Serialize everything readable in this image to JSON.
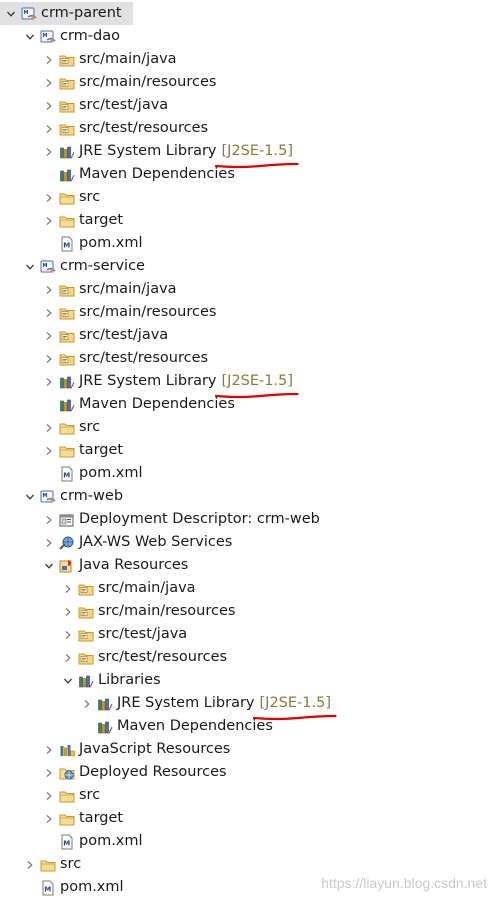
{
  "tree": [
    {
      "label": "crm-parent",
      "level": 0,
      "arrow": "expanded",
      "icon": "maven-project-icon",
      "selected": true
    },
    {
      "label": "crm-dao",
      "level": 1,
      "arrow": "expanded",
      "icon": "maven-project-icon"
    },
    {
      "label": "src/main/java",
      "level": 2,
      "arrow": "collapsed",
      "icon": "source-folder-icon"
    },
    {
      "label": "src/main/resources",
      "level": 2,
      "arrow": "collapsed",
      "icon": "source-folder-icon"
    },
    {
      "label": "src/test/java",
      "level": 2,
      "arrow": "collapsed",
      "icon": "source-folder-icon"
    },
    {
      "label": "src/test/resources",
      "level": 2,
      "arrow": "collapsed",
      "icon": "source-folder-icon"
    },
    {
      "label": "JRE System Library",
      "suffix": "[J2SE-1.5]",
      "level": 2,
      "arrow": "collapsed",
      "icon": "library-icon",
      "underline": true
    },
    {
      "label": "Maven Dependencies",
      "level": 2,
      "arrow": "none",
      "icon": "library-icon"
    },
    {
      "label": "src",
      "level": 2,
      "arrow": "collapsed",
      "icon": "folder-icon"
    },
    {
      "label": "target",
      "level": 2,
      "arrow": "collapsed",
      "icon": "folder-icon"
    },
    {
      "label": "pom.xml",
      "level": 2,
      "arrow": "none",
      "icon": "pom-file-icon"
    },
    {
      "label": "crm-service",
      "level": 1,
      "arrow": "expanded",
      "icon": "maven-project-icon"
    },
    {
      "label": "src/main/java",
      "level": 2,
      "arrow": "collapsed",
      "icon": "source-folder-icon"
    },
    {
      "label": "src/main/resources",
      "level": 2,
      "arrow": "collapsed",
      "icon": "source-folder-icon"
    },
    {
      "label": "src/test/java",
      "level": 2,
      "arrow": "collapsed",
      "icon": "source-folder-icon"
    },
    {
      "label": "src/test/resources",
      "level": 2,
      "arrow": "collapsed",
      "icon": "source-folder-icon"
    },
    {
      "label": "JRE System Library",
      "suffix": "[J2SE-1.5]",
      "level": 2,
      "arrow": "collapsed",
      "icon": "library-icon",
      "underline": true
    },
    {
      "label": "Maven Dependencies",
      "level": 2,
      "arrow": "none",
      "icon": "library-icon"
    },
    {
      "label": "src",
      "level": 2,
      "arrow": "collapsed",
      "icon": "folder-icon"
    },
    {
      "label": "target",
      "level": 2,
      "arrow": "collapsed",
      "icon": "folder-icon"
    },
    {
      "label": "pom.xml",
      "level": 2,
      "arrow": "none",
      "icon": "pom-file-icon"
    },
    {
      "label": "crm-web",
      "level": 1,
      "arrow": "expanded",
      "icon": "maven-project-icon"
    },
    {
      "label": "Deployment Descriptor: crm-web",
      "level": 2,
      "arrow": "collapsed",
      "icon": "deployment-descriptor-icon"
    },
    {
      "label": "JAX-WS Web Services",
      "level": 2,
      "arrow": "collapsed",
      "icon": "web-services-icon"
    },
    {
      "label": "Java Resources",
      "level": 2,
      "arrow": "expanded",
      "icon": "java-resources-icon"
    },
    {
      "label": "src/main/java",
      "level": 3,
      "arrow": "collapsed",
      "icon": "source-folder-icon"
    },
    {
      "label": "src/main/resources",
      "level": 3,
      "arrow": "collapsed",
      "icon": "source-folder-icon"
    },
    {
      "label": "src/test/java",
      "level": 3,
      "arrow": "collapsed",
      "icon": "source-folder-icon"
    },
    {
      "label": "src/test/resources",
      "level": 3,
      "arrow": "collapsed",
      "icon": "source-folder-icon"
    },
    {
      "label": "Libraries",
      "level": 3,
      "arrow": "expanded",
      "icon": "library-icon"
    },
    {
      "label": "JRE System Library",
      "suffix": "[J2SE-1.5]",
      "level": 4,
      "arrow": "collapsed",
      "icon": "library-icon",
      "underline": true
    },
    {
      "label": "Maven Dependencies",
      "level": 4,
      "arrow": "none",
      "icon": "library-icon"
    },
    {
      "label": "JavaScript Resources",
      "level": 2,
      "arrow": "collapsed",
      "icon": "javascript-resources-icon"
    },
    {
      "label": "Deployed Resources",
      "level": 2,
      "arrow": "collapsed",
      "icon": "deployed-resources-icon"
    },
    {
      "label": "src",
      "level": 2,
      "arrow": "collapsed",
      "icon": "folder-icon"
    },
    {
      "label": "target",
      "level": 2,
      "arrow": "collapsed",
      "icon": "folder-icon"
    },
    {
      "label": "pom.xml",
      "level": 2,
      "arrow": "none",
      "icon": "pom-file-icon"
    },
    {
      "label": "src",
      "level": 1,
      "arrow": "collapsed",
      "icon": "folder-icon"
    },
    {
      "label": "pom.xml",
      "level": 1,
      "arrow": "none",
      "icon": "pom-file-icon"
    }
  ],
  "watermark": "https://liayun.blog.csdn.net",
  "colors": {
    "selection": "#e1e1e1",
    "suffix": "#8b7a3a",
    "underline": "#e00000"
  }
}
